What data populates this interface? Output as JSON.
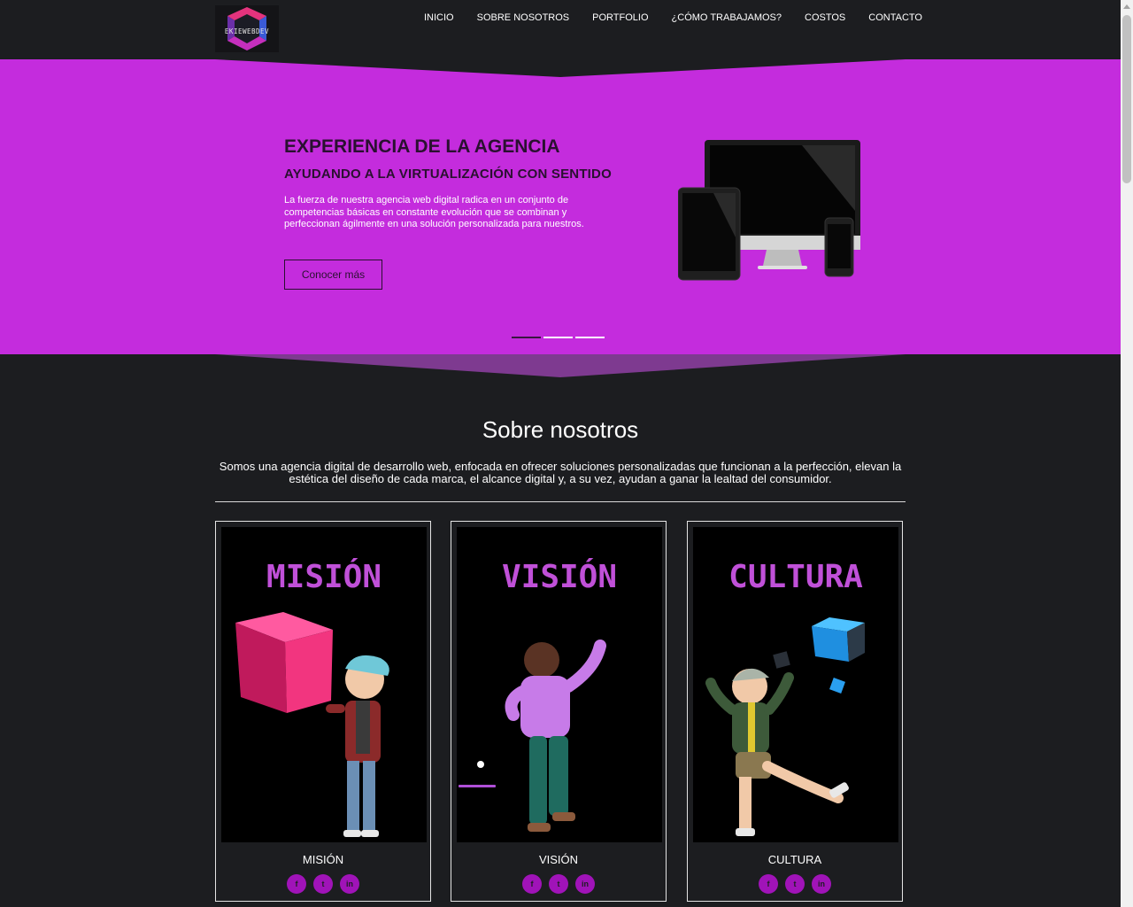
{
  "brand": {
    "logo_text": "EKIEWEBDEV"
  },
  "nav": {
    "items": [
      "INICIO",
      "SOBRE NOSOTROS",
      "PORTFOLIO",
      "¿CÓMO TRABAJAMOS?",
      "COSTOS",
      "CONTACTO"
    ]
  },
  "hero": {
    "title": "EXPERIENCIA DE LA AGENCIA",
    "subtitle": "AYUDANDO A LA VIRTUALIZACIÓN CON SENTIDO",
    "text": "La fuerza de nuestra agencia web digital radica en un conjunto de competencias básicas en constante evolución que se combinan y perfeccionan ágilmente en una solución personalizada para nuestros.",
    "button": "Conocer más",
    "slide_count": 3,
    "active_slide": 1
  },
  "about": {
    "title": "Sobre nosotros",
    "text": "Somos una agencia digital de desarrollo web, enfocada en ofrecer soluciones personalizadas que funcionan a la perfección, elevan la estética del diseño de cada marca, el alcance digital y, a su vez, ayudan a ganar la lealtad del consumidor."
  },
  "cards": [
    {
      "image_title": "MISIÓN",
      "label": "MISIÓN",
      "socials": [
        "f",
        "t",
        "in"
      ]
    },
    {
      "image_title": "VISIÓN",
      "label": "VISIÓN",
      "socials": [
        "f",
        "t",
        "in"
      ]
    },
    {
      "image_title": "CULTURA",
      "label": "CULTURA",
      "socials": [
        "f",
        "t",
        "in"
      ]
    }
  ],
  "colors": {
    "background": "#1c1d20",
    "hero": "#c42cdd",
    "hero_text_dark": "#2a1030",
    "card_title": "#c050d8",
    "social": "#a013b8",
    "band": "#7e3a90"
  },
  "icons": [
    "facebook-icon",
    "twitter-icon",
    "linkedin-icon"
  ]
}
